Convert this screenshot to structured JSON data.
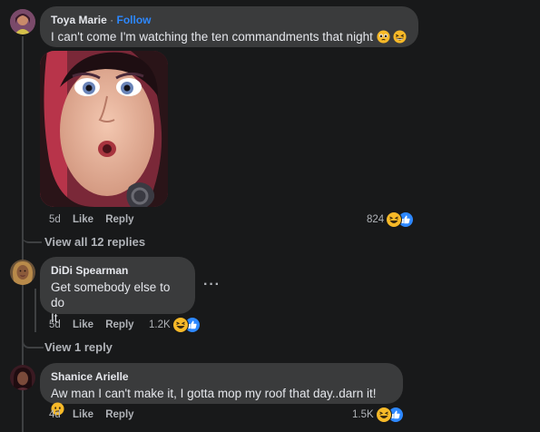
{
  "comments": [
    {
      "author": "Toya Marie",
      "separator": "·",
      "follow_label": "Follow",
      "text": "I can't come I'm watching the ten commandments that night",
      "emojis": [
        "face-with-pleading-eyes-emoji",
        "grinning-squinting-face-emoji"
      ],
      "has_gif": true,
      "time": "5d",
      "like_label": "Like",
      "reply_label": "Reply",
      "reaction_count": "824",
      "reactions": [
        "haha-reaction-icon",
        "like-reaction-icon"
      ],
      "view_replies": "View all 12 replies"
    },
    {
      "author": "DiDi Spearman",
      "text_line1": "Get somebody else to do",
      "text_line2": "It.",
      "more_label": "···",
      "time": "5d",
      "like_label": "Like",
      "reply_label": "Reply",
      "reaction_count": "1.2K",
      "reactions": [
        "haha-reaction-icon",
        "like-reaction-icon"
      ],
      "view_replies": "View 1 reply"
    },
    {
      "author": "Shanice Arielle",
      "text": "Aw man I can't make it, I gotta mop my roof that day..darn it!",
      "emojis": [
        "neutral-face-emoji"
      ],
      "time": "4d",
      "like_label": "Like",
      "reply_label": "Reply",
      "reaction_count": "1.5K",
      "reactions": [
        "haha-reaction-icon",
        "like-reaction-icon"
      ]
    }
  ],
  "colors": {
    "background": "#18191a",
    "bubble": "#3a3b3c",
    "text_primary": "#e4e6eb",
    "text_secondary": "#b0b3b8",
    "link_blue": "#2d88ff",
    "haha_yellow": "#f7b928"
  }
}
